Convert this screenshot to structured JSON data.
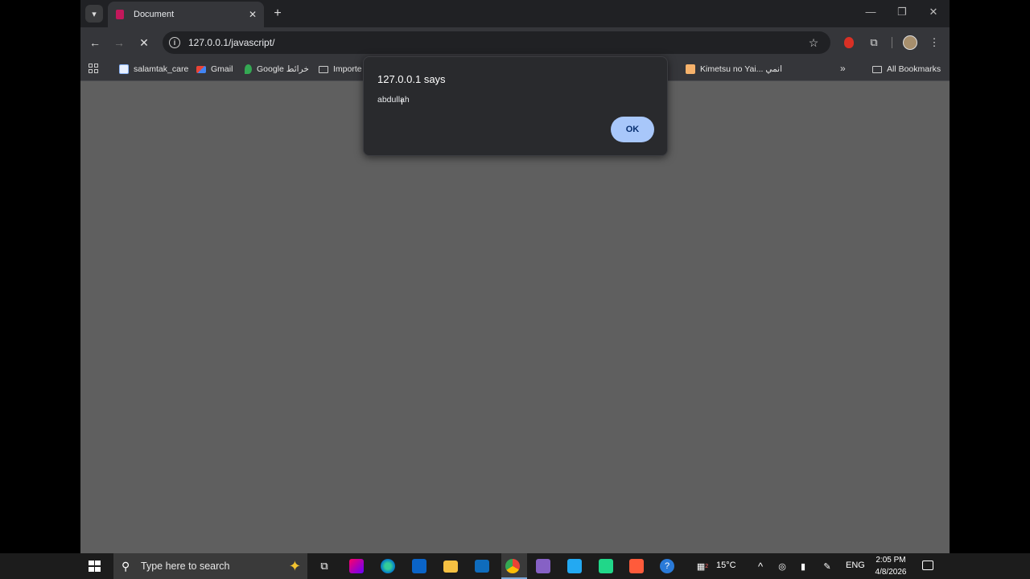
{
  "browser": {
    "tab": {
      "title": "Document"
    },
    "address": {
      "url": "127.0.0.1/javascript/"
    },
    "bookmarks": [
      {
        "label": "salamtak_care",
        "icon": "doc-icon"
      },
      {
        "label": "Gmail",
        "icon": "gmail-icon"
      },
      {
        "label": "Google خرائط",
        "icon": "maps-icon"
      },
      {
        "label": "Importe",
        "icon": "folder-icon"
      },
      {
        "label": "Kimetsu no Yai... انمي",
        "icon": "video-icon"
      },
      {
        "label": "All Bookmarks",
        "icon": "folder-icon"
      }
    ]
  },
  "dialog": {
    "title": "127.0.0.1 says",
    "message": "abdullah",
    "ok_label": "OK"
  },
  "taskbar": {
    "search_placeholder": "Type here to search",
    "weather": "15°C",
    "language": "ENG",
    "time": "2:05 PM",
    "date": "4/8/2026",
    "weather_badge": "2"
  },
  "colors": {
    "ok_button": "#a8c7fa",
    "page_dim": "#5f5f5f",
    "toolbar": "#35363a"
  }
}
